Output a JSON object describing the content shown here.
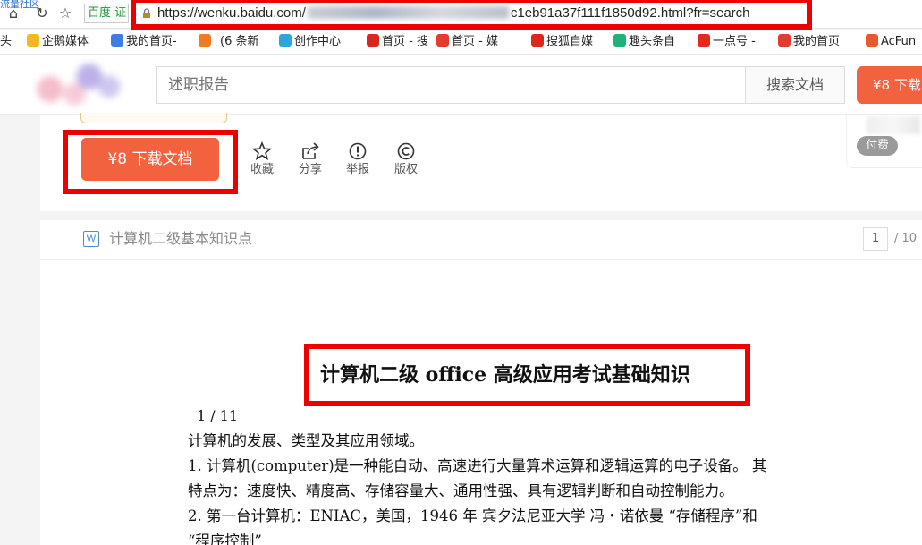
{
  "browser": {
    "site_tag": "流量社区",
    "brand_label": "百度 证",
    "url_prefix": "https://wenku.",
    "url_host": "baidu.com/",
    "url_suffix": "c1eb91a37f111f1850d92.html?fr=search"
  },
  "bookmarks": [
    {
      "label": "头",
      "color": "#ffffff"
    },
    {
      "label": "企鹅媒体",
      "color": "#f3b81f"
    },
    {
      "label": "我的首页-",
      "color": "#3d7ee6"
    },
    {
      "label": "",
      "color": "#f07b23"
    },
    {
      "label": "(6 条新",
      "color": "#ffffff"
    },
    {
      "label": "创作中心",
      "color": "#2aa6e0"
    },
    {
      "label": "首页 - 搜",
      "color": "#d8281d"
    },
    {
      "label": "首页 - 媒",
      "color": "#e33b2e"
    },
    {
      "label": "搜狐自媒",
      "color": "#e0251b"
    },
    {
      "label": "趣头条自",
      "color": "#1fb07c"
    },
    {
      "label": "一点号 -",
      "color": "#e8281b"
    },
    {
      "label": "我的首页",
      "color": "#e33b2e"
    },
    {
      "label": "AcFun",
      "color": "#e85a2a"
    }
  ],
  "header": {
    "search_placeholder": "述职报告",
    "search_button": "搜索文档",
    "download_top": "¥8 下载"
  },
  "actions": {
    "download_button": "¥8   下载文档",
    "items": [
      {
        "label": "收藏",
        "icon": "star-icon"
      },
      {
        "label": "分享",
        "icon": "share-icon"
      },
      {
        "label": "举报",
        "icon": "report-icon"
      },
      {
        "label": "版权",
        "icon": "copyright-icon"
      }
    ],
    "paid_tag": "付费"
  },
  "viewer": {
    "doc_name": "计算机二级基本知识点",
    "page_current": "1",
    "page_total": "/ 10",
    "title": "计算机二级 office  高级应用考试基础知识",
    "page_marker": "1  /  11",
    "paragraphs": [
      "计算机的发展、类型及其应用领域。",
      "1.  计算机(computer)是一种能自动、高速进行大量算术运算和逻辑运算的电子设备。  其",
      "特点为：速度快、精度高、存储容量大、通用性强、具有逻辑判断和自动控制能力。",
      "2.  第一台计算机：ENIAC，美国，1946  年  宾夕法尼亚大学  冯・诺依曼  “存储程序”和",
      "“程序控制”"
    ]
  },
  "colors": {
    "accent": "#f2623e",
    "highlight_border": "#ee0000"
  }
}
